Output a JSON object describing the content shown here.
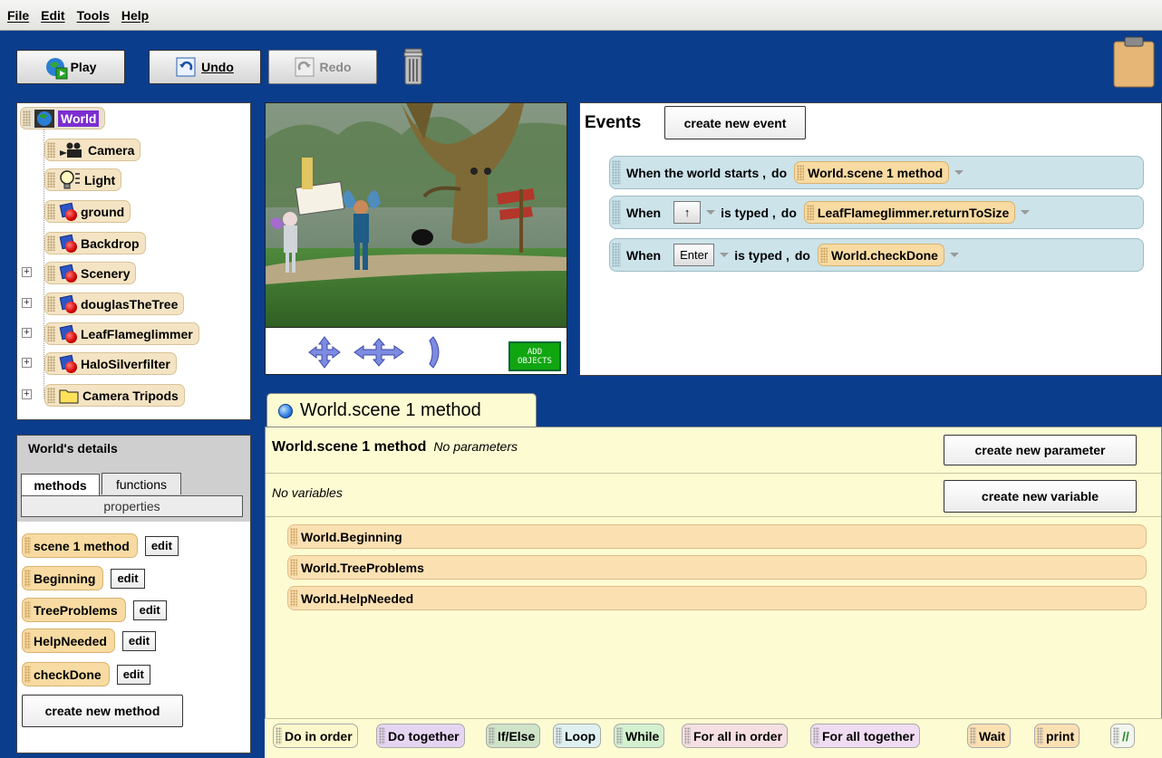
{
  "menu": [
    "File",
    "Edit",
    "Tools",
    "Help"
  ],
  "toolbar": {
    "play": "Play",
    "undo": "Undo",
    "redo": "Redo"
  },
  "tree": {
    "root": "World",
    "items": [
      "Camera",
      "Light",
      "ground",
      "Backdrop",
      "Scenery",
      "douglasTheTree",
      "LeafFlameglimmer",
      "HaloSilverfilter",
      "Camera Tripods"
    ]
  },
  "scene": {
    "add_objects": [
      "ADD",
      "OBJECTS"
    ]
  },
  "events": {
    "title": "Events",
    "create_button": "create new event",
    "rows": [
      {
        "when": "When the world starts ,",
        "do": "do",
        "method": "World.scene 1 method"
      },
      {
        "when": "When",
        "key": "↑",
        "typed": "is typed ,",
        "do": "do",
        "method": "LeafFlameglimmer.returnToSize"
      },
      {
        "when": "When",
        "key": "Enter",
        "typed": "is typed ,",
        "do": "do",
        "method": "World.checkDone"
      }
    ]
  },
  "details": {
    "title": "World's details",
    "tabs": {
      "methods": "methods",
      "functions": "functions",
      "properties": "properties"
    },
    "methods": [
      "scene 1 method",
      "Beginning",
      "TreeProblems",
      "HelpNeeded",
      "checkDone"
    ],
    "edit_label": "edit",
    "create_method": "create new method"
  },
  "editor": {
    "tab_label": "World.scene 1 method",
    "method_name": "World.scene 1 method",
    "params_text": "No parameters",
    "create_param": "create new parameter",
    "variables_text": "No variables",
    "create_variable": "create new variable",
    "statements": [
      "World.Beginning",
      "World.TreeProblems",
      "World.HelpNeeded"
    ]
  },
  "palette": [
    "Do in order",
    "Do together",
    "If/Else",
    "Loop",
    "While",
    "For all in order",
    "For all together",
    "Wait",
    "print",
    "//"
  ],
  "colors": {
    "background": "#0b3d8d",
    "event_row": "#cce3ea",
    "method_tile": "#f7dba2",
    "editor_bg": "#fdfbd2",
    "world_highlight": "#7b2fd1"
  }
}
